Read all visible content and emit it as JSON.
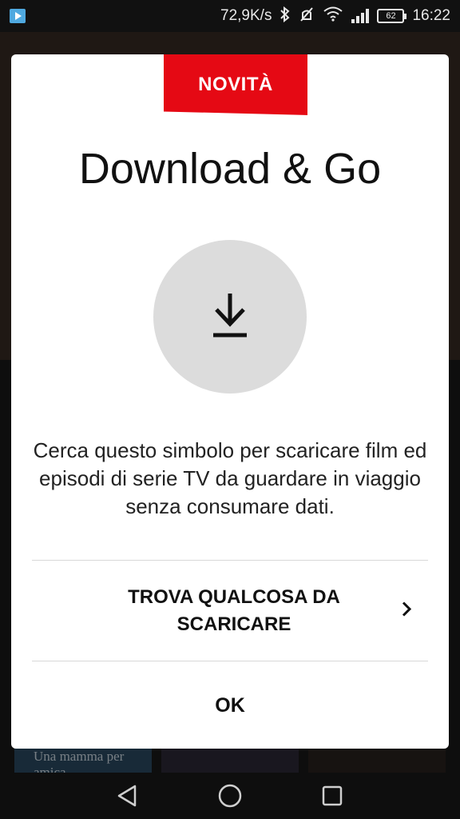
{
  "status_bar": {
    "network_speed": "72,9K/s",
    "battery_level": "62",
    "time": "16:22",
    "icons": [
      "play-store-icon",
      "bluetooth-icon",
      "vibrate-icon",
      "wifi-icon",
      "signal-icon",
      "battery-icon"
    ]
  },
  "background": {
    "tile_text": "Una mamma per amica"
  },
  "dialog": {
    "badge": "NOVITÀ",
    "title": "Download & Go",
    "icon": "download-icon",
    "description": "Cerca questo simbolo per scaricare film ed episodi di serie TV da guardare in viaggio senza consumare dati.",
    "action_label": "TROVA QUALCOSA DA SCARICARE",
    "ok_label": "OK",
    "accent_color": "#e50914",
    "circle_color": "#dcdcdc"
  },
  "nav_bar": {
    "icons": [
      "back-icon",
      "home-icon",
      "recents-icon"
    ]
  }
}
